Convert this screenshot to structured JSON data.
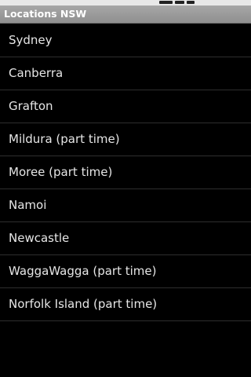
{
  "app_bar": {
    "title": "Locations NSW"
  },
  "locations": [
    {
      "label": "Sydney"
    },
    {
      "label": "Canberra"
    },
    {
      "label": "Grafton"
    },
    {
      "label": "Mildura (part time)"
    },
    {
      "label": "Moree (part time)"
    },
    {
      "label": "Namoi"
    },
    {
      "label": "Newcastle"
    },
    {
      "label": "WaggaWagga (part time)"
    },
    {
      "label": "Norfolk Island (part time)"
    }
  ],
  "colors": {
    "background": "#000000",
    "title_bar": "#9a9a9a",
    "title_text": "#ffffff",
    "item_text": "#e6e6e6",
    "divider": "#2e2e2e"
  }
}
